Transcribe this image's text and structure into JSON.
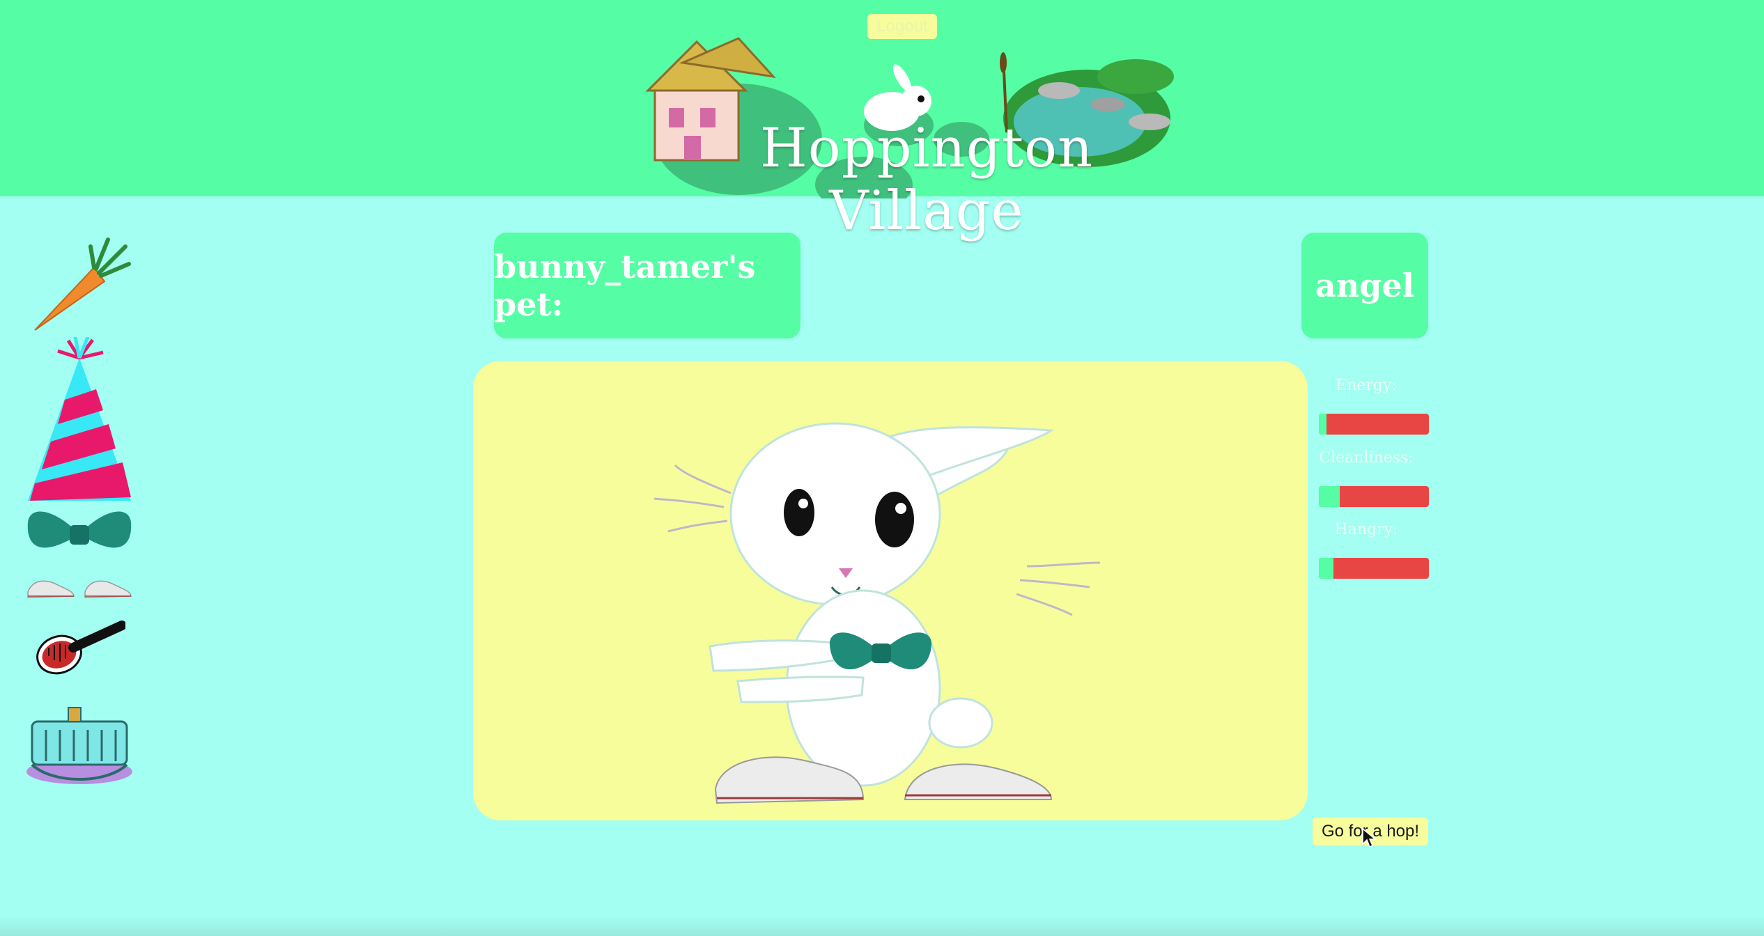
{
  "header": {
    "logout_label": "Logout",
    "site_title": "Hoppington Village",
    "background_color": "#55fea4"
  },
  "sidebar": {
    "items": [
      {
        "name": "carrot-icon"
      },
      {
        "name": "party-hat-icon"
      },
      {
        "name": "bow-tie-icon"
      },
      {
        "name": "sneakers-icon"
      },
      {
        "name": "hair-brush-icon"
      },
      {
        "name": "cradle-icon"
      }
    ]
  },
  "main": {
    "owner_label": "bunny_tamer's pet:",
    "pet_name": "angel",
    "stage_color": "#f8fd9c"
  },
  "stats": [
    {
      "label": "Energy:",
      "level": 0.07
    },
    {
      "label": "Cleanliness:",
      "level": 0.19
    },
    {
      "label": "Hangry:",
      "level": 0.13
    }
  ],
  "actions": {
    "hop_label": "Go for a hop!"
  },
  "colors": {
    "page_bg": "#a3fff2",
    "bar_fill": "#55fea4",
    "bar_empty": "#e84545",
    "button_bg": "#f7fd9c"
  }
}
